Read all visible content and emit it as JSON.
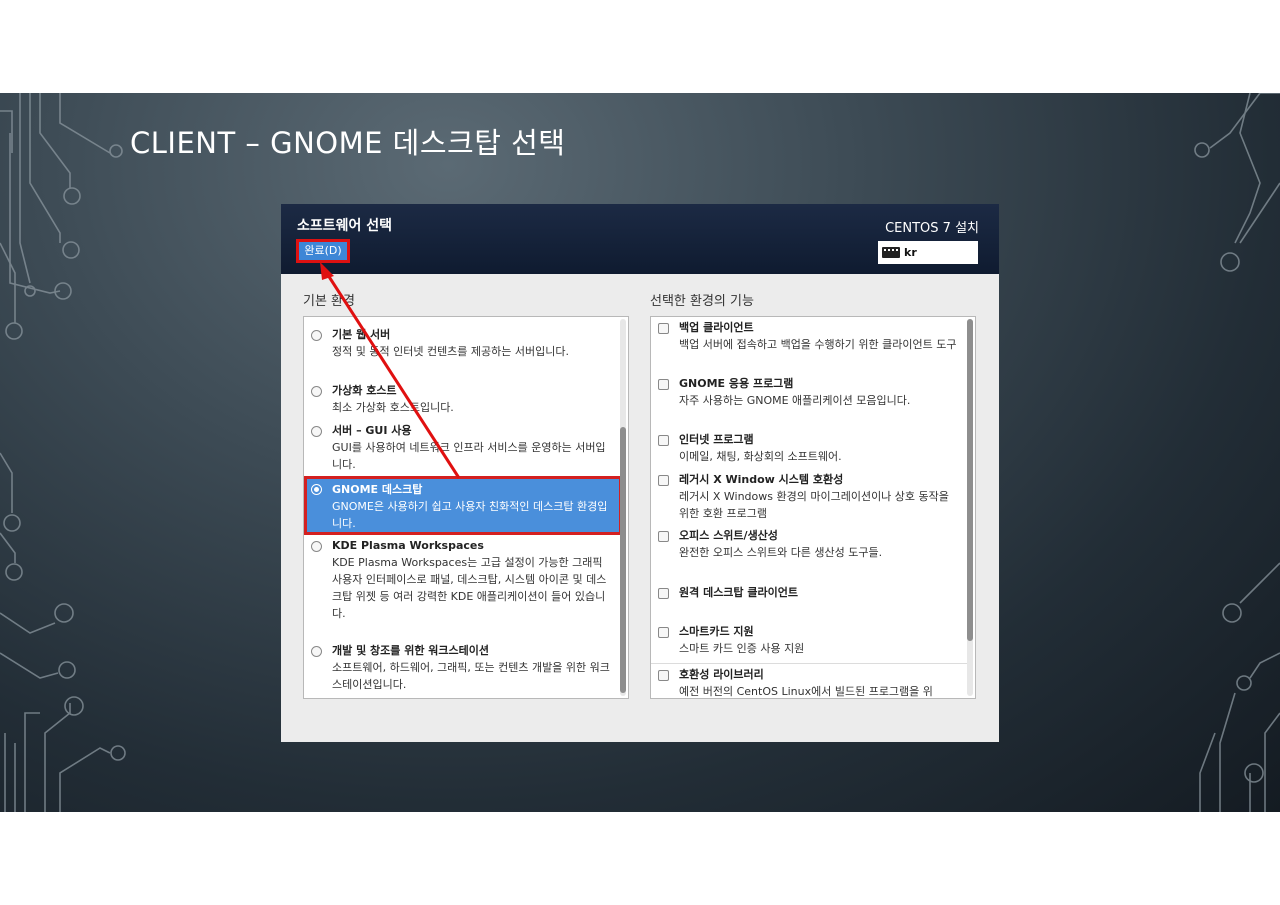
{
  "slide": {
    "title": "CLIENT – GNOME 데스크탑 선택"
  },
  "installer": {
    "header_title": "소프트웨어 선택",
    "done_button": "완료(D)",
    "install_title": "CENTOS 7 설치",
    "keyboard_layout": "kr"
  },
  "base_env": {
    "label": "기본 환경",
    "items": [
      {
        "title": "기본 웹 서버",
        "desc": "정적 및 동적 인터넷 컨텐츠를 제공하는 서버입니다."
      },
      {
        "title": "가상화 호스트",
        "desc": "최소 가상화 호스트입니다."
      },
      {
        "title": "서버 – GUI 사용",
        "desc": "GUI를 사용하여 네트워크 인프라 서비스를 운영하는 서버입니다."
      },
      {
        "title": "GNOME 데스크탑",
        "desc": "GNOME은 사용하기 쉽고 사용자 친화적인 데스크탑 환경입니다.",
        "selected": true
      },
      {
        "title": "KDE Plasma Workspaces",
        "desc": "KDE Plasma Workspaces는 고급 설정이 가능한 그래픽 사용자 인터페이스로 패널, 데스크탑, 시스템 아이콘 및 데스크탑 위젯 등 여러 강력한 KDE 애플리케이션이 들어 있습니다."
      },
      {
        "title": "개발 및 창조를 위한 워크스테이션",
        "desc": "소프트웨어, 하드웨어, 그래픽, 또는 컨텐츠 개발을 위한 워크스테이션입니다."
      }
    ]
  },
  "addons": {
    "label": "선택한 환경의 기능",
    "items": [
      {
        "title": "백업 클라이언트",
        "desc": "백업 서버에 접속하고 백업을 수행하기 위한 클라이언트 도구"
      },
      {
        "title": "GNOME 응용 프로그램",
        "desc": "자주 사용하는 GNOME 애플리케이션 모음입니다."
      },
      {
        "title": "인터넷 프로그램",
        "desc": "이메일, 채팅, 화상회의 소프트웨어."
      },
      {
        "title": "레거시 X Window 시스템 호환성",
        "desc": "레거시 X Windows 환경의 마이그레이션이나 상호 동작을 위한 호환 프로그램"
      },
      {
        "title": "오피스 스위트/생산성",
        "desc": "완전한 오피스 스위트와 다른 생산성 도구들."
      },
      {
        "title": "원격 데스크탑 클라이언트",
        "desc": ""
      },
      {
        "title": "스마트카드 지원",
        "desc": "스마트 카드 인증 사용 지원"
      },
      {
        "title": "호환성 라이브러리",
        "desc": "예전 버전의 CentOS Linux에서 빌드된 프로그램을 위"
      }
    ]
  },
  "colors": {
    "highlight_border": "#d42020",
    "selected_bg": "#4a8fdb",
    "header_bg": "#13203a"
  },
  "icons": [
    "keyboard-icon"
  ]
}
